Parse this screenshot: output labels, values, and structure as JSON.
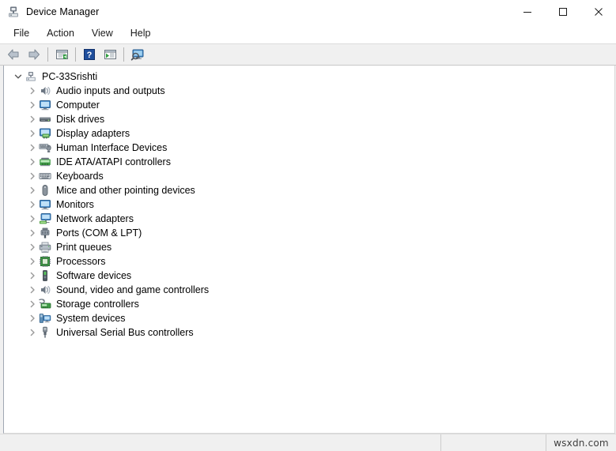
{
  "window": {
    "title": "Device Manager",
    "title_icon": "device-manager-icon",
    "controls": [
      {
        "name": "minimize-button",
        "glyph": "minimize"
      },
      {
        "name": "maximize-button",
        "glyph": "maximize"
      },
      {
        "name": "close-button",
        "glyph": "close"
      }
    ]
  },
  "menubar": {
    "items": [
      {
        "label": "File",
        "name": "menu-file"
      },
      {
        "label": "Action",
        "name": "menu-action"
      },
      {
        "label": "View",
        "name": "menu-view"
      },
      {
        "label": "Help",
        "name": "menu-help"
      }
    ]
  },
  "toolbar": {
    "buttons": [
      {
        "name": "back-button",
        "icon": "back-arrow-icon"
      },
      {
        "name": "forward-button",
        "icon": "forward-arrow-icon"
      },
      {
        "name": "separator-1",
        "icon": "separator"
      },
      {
        "name": "properties-button",
        "icon": "properties-panel-icon"
      },
      {
        "name": "separator-2",
        "icon": "separator"
      },
      {
        "name": "help-button",
        "icon": "help-question-icon"
      },
      {
        "name": "show-hidden-devices-button",
        "icon": "panel-play-icon"
      },
      {
        "name": "separator-3",
        "icon": "separator"
      },
      {
        "name": "scan-hardware-changes-button",
        "icon": "monitor-scan-icon"
      }
    ]
  },
  "tree": {
    "root": {
      "label": "PC-33Srishti",
      "icon": "computer-node-icon",
      "expanded": true,
      "twisty": "chevron-down-icon"
    },
    "nodes": [
      {
        "label": "Audio inputs and outputs",
        "icon": "speaker-icon",
        "twisty": "chevron-right-icon"
      },
      {
        "label": "Computer",
        "icon": "monitor-icon",
        "twisty": "chevron-right-icon"
      },
      {
        "label": "Disk drives",
        "icon": "disk-drive-icon",
        "twisty": "chevron-right-icon"
      },
      {
        "label": "Display adapters",
        "icon": "display-adapter-icon",
        "twisty": "chevron-right-icon"
      },
      {
        "label": "Human Interface Devices",
        "icon": "hid-icon",
        "twisty": "chevron-right-icon"
      },
      {
        "label": "IDE ATA/ATAPI controllers",
        "icon": "ide-controller-icon",
        "twisty": "chevron-right-icon"
      },
      {
        "label": "Keyboards",
        "icon": "keyboard-icon",
        "twisty": "chevron-right-icon"
      },
      {
        "label": "Mice and other pointing devices",
        "icon": "mouse-icon",
        "twisty": "chevron-right-icon"
      },
      {
        "label": "Monitors",
        "icon": "monitor-icon",
        "twisty": "chevron-right-icon"
      },
      {
        "label": "Network adapters",
        "icon": "network-adapter-icon",
        "twisty": "chevron-right-icon"
      },
      {
        "label": "Ports (COM & LPT)",
        "icon": "port-connector-icon",
        "twisty": "chevron-right-icon"
      },
      {
        "label": "Print queues",
        "icon": "printer-icon",
        "twisty": "chevron-right-icon"
      },
      {
        "label": "Processors",
        "icon": "processor-chip-icon",
        "twisty": "chevron-right-icon"
      },
      {
        "label": "Software devices",
        "icon": "software-device-icon",
        "twisty": "chevron-right-icon"
      },
      {
        "label": "Sound, video and game controllers",
        "icon": "speaker-icon",
        "twisty": "chevron-right-icon"
      },
      {
        "label": "Storage controllers",
        "icon": "storage-controller-icon",
        "twisty": "chevron-right-icon"
      },
      {
        "label": "System devices",
        "icon": "system-device-icon",
        "twisty": "chevron-right-icon"
      },
      {
        "label": "Universal Serial Bus controllers",
        "icon": "usb-icon",
        "twisty": "chevron-right-icon"
      }
    ]
  },
  "statusbar": {
    "main_text": "",
    "mid_text": "",
    "watermark": "wsxdn.com"
  },
  "colors": {
    "window_bg": "#ffffff",
    "chrome_bg": "#f0f0f0",
    "text": "#000000",
    "accent_blue": "#2c5f9e",
    "icon_blue": "#3a8fd6",
    "icon_green": "#4a9c3c"
  }
}
